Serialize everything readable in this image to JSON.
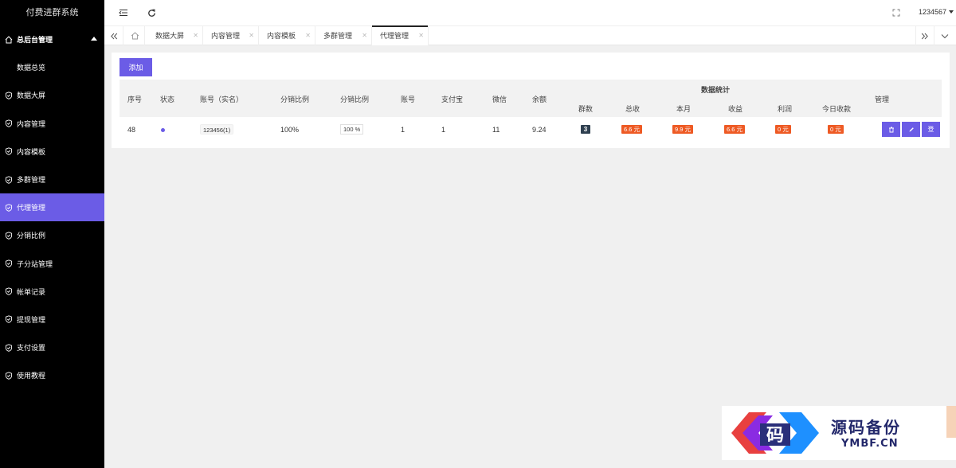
{
  "app": {
    "title": "付费进群系统"
  },
  "sidebar": {
    "group": {
      "label": "总后台管理"
    },
    "items": [
      {
        "label": "数据总览"
      },
      {
        "label": "数据大屏"
      },
      {
        "label": "内容管理"
      },
      {
        "label": "内容模板"
      },
      {
        "label": "多群管理"
      },
      {
        "label": "代理管理",
        "active": true
      },
      {
        "label": "分销比例"
      },
      {
        "label": "子分站管理"
      },
      {
        "label": "帐单记录"
      },
      {
        "label": "提现管理"
      },
      {
        "label": "支付设置"
      },
      {
        "label": "使用教程"
      }
    ]
  },
  "header": {
    "user": "1234567"
  },
  "tabs": [
    {
      "label": "数据大屏"
    },
    {
      "label": "内容管理"
    },
    {
      "label": "内容模板"
    },
    {
      "label": "多群管理"
    },
    {
      "label": "代理管理",
      "active": true
    }
  ],
  "toolbar": {
    "add_label": "添加"
  },
  "table": {
    "headers": {
      "seq": "序号",
      "status": "状态",
      "account_name": "账号（实名）",
      "ratio1": "分销比例",
      "ratio2": "分销比例",
      "account": "账号",
      "alipay": "支付宝",
      "wechat": "微信",
      "balance": "余额",
      "stats_group": "数据统计",
      "groups": "群数",
      "total": "总收",
      "month": "本月",
      "income": "收益",
      "profit": "利润",
      "today": "今日收款",
      "manage": "管理"
    },
    "rows": [
      {
        "seq": "48",
        "account_name": "123456(1)",
        "ratio1": "100%",
        "ratio2": "100 %",
        "account": "1",
        "alipay": "1",
        "wechat": "11",
        "balance": "9.24",
        "groups": "3",
        "total": "6.6 元",
        "month": "9.9 元",
        "income": "6.6 元",
        "profit": "0 元",
        "today": "0 元",
        "actions": {
          "delete": "🗑",
          "edit": "✎",
          "login": "登"
        }
      }
    ]
  },
  "watermark": {
    "cn": "源码备份",
    "en": "YMBF.CN",
    "logo_char": "码"
  },
  "colors": {
    "accent": "#6b5ce6",
    "sidebar_bg": "#000000",
    "badge_orange": "#ee5a24",
    "badge_dark": "#2f4050"
  }
}
